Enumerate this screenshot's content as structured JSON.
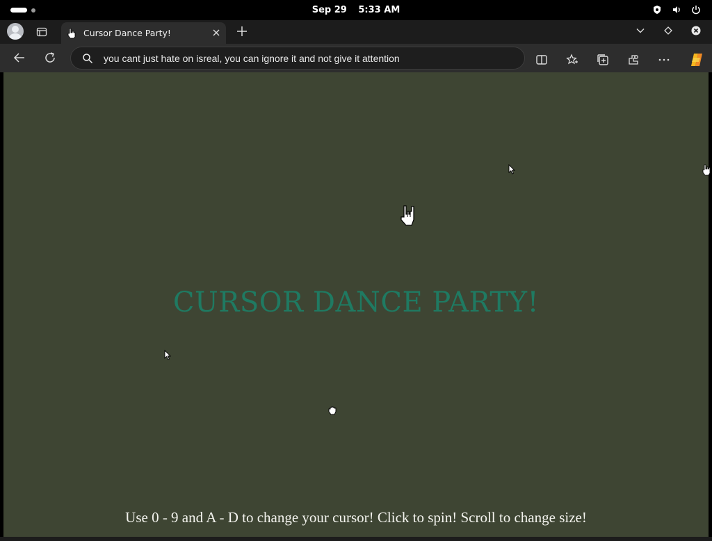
{
  "system_bar": {
    "date": "Sep 29",
    "time": "5:33 AM",
    "icons": [
      "shield-icon",
      "volume-icon",
      "power-icon"
    ]
  },
  "browser": {
    "tab": {
      "title": "Cursor Dance Party!",
      "favicon": "hand-cursor-icon"
    },
    "address_bar": {
      "value": "you cant just hate on isreal, you can ignore it and not give it attention",
      "icon": "search-icon"
    },
    "toolbar_icons": [
      "split-screen-icon",
      "favorites-icon",
      "collections-icon",
      "extensions-icon",
      "more-icon",
      "copilot-icon"
    ]
  },
  "page": {
    "title": "CURSOR DANCE PARTY!",
    "instructions": "Use 0 - 9 and A - D to change your cursor! Click to spin! Scroll to change size!",
    "background_color": "#3e4533",
    "title_color": "#1f7a62",
    "cursors": [
      "arrow-cursor-icon",
      "hand-cursor-icon",
      "rock-hand-cursor-icon",
      "arrow-cursor-icon",
      "grab-hand-cursor-icon"
    ]
  }
}
